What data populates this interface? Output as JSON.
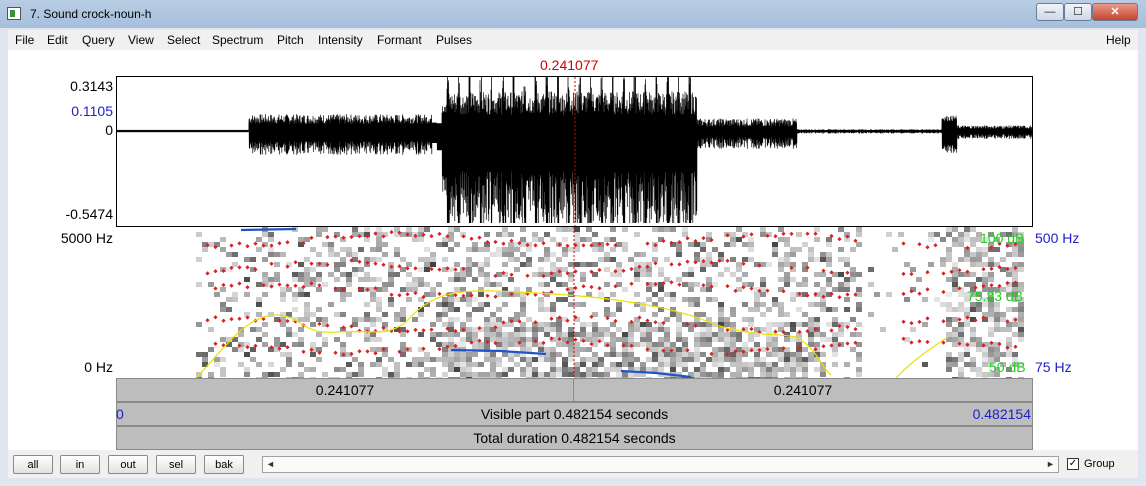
{
  "window": {
    "title": "7. Sound crock-noun-h",
    "minimize": "—",
    "maximize": "☐",
    "close": "✕"
  },
  "menu": [
    "File",
    "Edit",
    "Query",
    "View",
    "Select",
    "Spectrum",
    "Pitch",
    "Intensity",
    "Formant",
    "Pulses"
  ],
  "help": "Help",
  "cursor": {
    "time": 0.241077,
    "label": "0.241077"
  },
  "waveform": {
    "ymax": "0.3143",
    "yval": "0.1105",
    "yzero": "0",
    "ymin": "-0.5474"
  },
  "spectrogram": {
    "freq_top": "5000 Hz",
    "freq_bottom": "0 Hz",
    "intensity_top": "100 dB",
    "intensity_mid": "75.83 dB",
    "intensity_bottom": "50 dB",
    "pitch_top": "500 Hz",
    "pitch_bottom": "75 Hz"
  },
  "selection_bar": {
    "left": "0.241077",
    "right": "0.241077"
  },
  "visible_bar": {
    "start": "0",
    "label": "Visible part 0.482154 seconds",
    "end": "0.482154"
  },
  "total_bar": {
    "label": "Total duration 0.482154 seconds"
  },
  "buttons": {
    "all": "all",
    "in": "in",
    "out": "out",
    "sel": "sel",
    "bak": "bak"
  },
  "scroll": {
    "left_arrow": "◄",
    "right_arrow": "►"
  },
  "group": {
    "label": "Group",
    "checked": "✓"
  },
  "colors": {
    "cursor": "#d40000",
    "pitch": "#1f55c8",
    "formant": "#e02020",
    "intensity": "#e8e200",
    "intensity_label": "#1fd21f",
    "axis_blue": "#2020c8"
  }
}
